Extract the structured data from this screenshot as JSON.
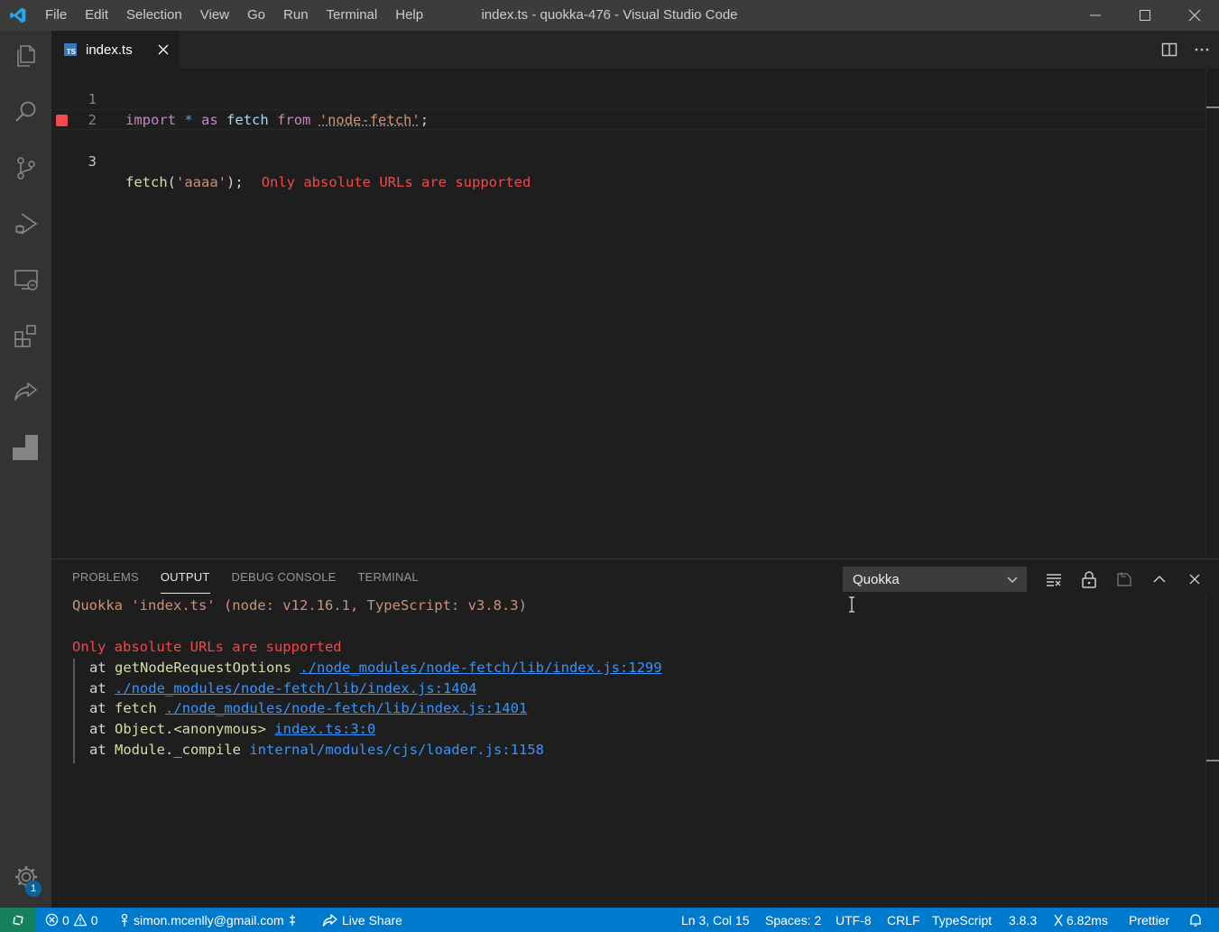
{
  "window": {
    "title": "index.ts - quokka-476 - Visual Studio Code",
    "menu": [
      "File",
      "Edit",
      "Selection",
      "View",
      "Go",
      "Run",
      "Terminal",
      "Help"
    ]
  },
  "activity_bar": {
    "items": [
      "files-icon",
      "search-icon",
      "source-control-icon",
      "run-debug-icon",
      "remote-explorer-icon",
      "extensions-icon",
      "live-share-icon",
      "quokka-icon"
    ],
    "settings_badge": "1"
  },
  "editor": {
    "tab": {
      "name": "index.ts",
      "icon": "TS"
    },
    "lines": [
      {
        "num": "1",
        "t1": "import",
        "t2": "*",
        "t3": "as",
        "t4": "fetch",
        "t5": "from",
        "t6": "'node-fetch'",
        "t7": ";"
      },
      {
        "num": "2"
      },
      {
        "num": "3",
        "fn": "fetch",
        "open": "(",
        "arg": "'aaaa'",
        "close": ");",
        "error": "Only absolute URLs are supported"
      }
    ]
  },
  "panel": {
    "tabs": [
      "PROBLEMS",
      "OUTPUT",
      "DEBUG CONSOLE",
      "TERMINAL"
    ],
    "active_tab": "OUTPUT",
    "output_channel": "Quokka",
    "output": {
      "header": "Quokka 'index.ts' (node: v12.16.1, TypeScript: v3.8.3)",
      "error": "Only absolute URLs are supported",
      "trace": [
        {
          "at": "at",
          "fn": "getNodeRequestOptions",
          "loc": "./node_modules/node-fetch/lib/index.js:1299"
        },
        {
          "at": "at",
          "fn": "",
          "loc": "./node_modules/node-fetch/lib/index.js:1404"
        },
        {
          "at": "at",
          "fn": "fetch",
          "loc": "./node_modules/node-fetch/lib/index.js:1401"
        },
        {
          "at": "at",
          "fn": "Object.<anonymous>",
          "loc": "index.ts:3:0"
        },
        {
          "at": "at",
          "fn": "Module._compile",
          "loc": "internal/modules/cjs/loader.js:1158"
        }
      ]
    }
  },
  "status_bar": {
    "errors": "0",
    "warnings": "0",
    "account": "simon.mcenlly@gmail.com",
    "live_share": "Live Share",
    "position": "Ln 3, Col 15",
    "spaces": "Spaces: 2",
    "encoding": "UTF-8",
    "eol": "CRLF",
    "language": "TypeScript",
    "ts_version": "3.8.3",
    "quokka_time": "6.82ms",
    "formatter": "Prettier"
  },
  "colors": {
    "accent": "#007acc",
    "remote": "#16825d",
    "error": "#f44747",
    "link": "#3794ff"
  }
}
